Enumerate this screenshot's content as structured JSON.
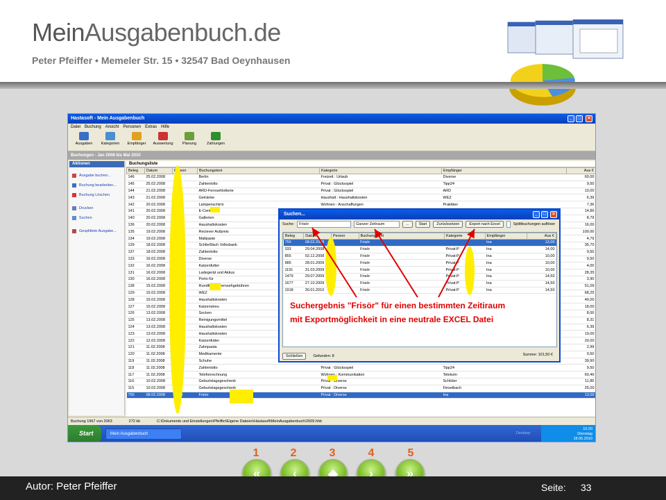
{
  "header": {
    "title_part1": "Mein",
    "title_part2": "Ausgabenbuch.de",
    "subtitle": "Peter Pfeiffer  •  Memeler Str. 15  •  32547 Bad Oeynhausen"
  },
  "app": {
    "window_title": "Hastasoft - Mein Ausgabenbuch",
    "menu": [
      "Datei",
      "Buchung",
      "Ansicht",
      "Personen",
      "Extras",
      "Hilfe"
    ],
    "toolbar": [
      {
        "label": "Ausgaben",
        "icon": "book-icon",
        "color": "#3a6fc4"
      },
      {
        "label": "Kategorien",
        "icon": "category-icon",
        "color": "#4a8fd4"
      },
      {
        "label": "Empfänger",
        "icon": "person-icon",
        "color": "#e0a020"
      },
      {
        "label": "Auswertung",
        "icon": "chart-icon",
        "color": "#c33"
      },
      {
        "label": "Planung",
        "icon": "planning-icon",
        "color": "#6a9f3a"
      },
      {
        "label": "Zahlungen",
        "icon": "money-icon",
        "color": "#2d8f2d"
      }
    ],
    "section_bar": "Buchungen - Jan 2008 bis Mai 2010",
    "actions": {
      "heading": "Aktionen",
      "items": [
        "Ausgabe buchen...",
        "Buchung bearbeiten...",
        "Buchung Löschen",
        "Drucken",
        "Suchen",
        "Gesplittete Ausgabe..."
      ]
    },
    "list_title": "Buchungsliste",
    "columns": [
      "Beleg",
      "Datum",
      "Person",
      "Buchungstext",
      "Kategorie",
      "Empfänger",
      "Aus €"
    ],
    "rows": [
      [
        "146",
        "25.02.2008",
        "",
        "Berlin",
        "Freizeit : Urlaub",
        "Diverse",
        "60,00"
      ],
      [
        "145",
        "25.02.2008",
        "P",
        "Zahlenlotto",
        "Privat : Glücksspiel",
        "Tipp24",
        "9,50"
      ],
      [
        "144",
        "21.02.2008",
        "",
        "ARD-Fernsehlotterie",
        "Privat : Glücksspiel",
        "ARD",
        "10,00"
      ],
      [
        "143",
        "21.02.2008",
        "",
        "Getränke",
        "Haushalt : Haushaltskosten",
        "WEZ",
        "6,39"
      ],
      [
        "142",
        "20.02.2008",
        "",
        "Lampenschirm",
        "Wohnen : Anschaffungen",
        "Praktiker",
        "7,36"
      ],
      [
        "141",
        "20.02.2008",
        "",
        "E-Center",
        "",
        "",
        "14,86"
      ],
      [
        "140",
        "20.02.2008",
        "",
        "Gallerien",
        "",
        "",
        "8,79"
      ],
      [
        "136",
        "20.02.2008",
        "",
        "Haushaltskosten",
        "",
        "",
        "16,00"
      ],
      [
        "135",
        "19.02.2008",
        "",
        "Reciever Aufpreis",
        "",
        "",
        "100,00"
      ],
      [
        "134",
        "19.02.2008",
        "",
        "Maltpaste",
        "",
        "",
        "4,79"
      ],
      [
        "139",
        "18.02.2008",
        "",
        "Schließfach Volksbank",
        "",
        "",
        "35,70"
      ],
      [
        "137",
        "18.02.2008",
        "",
        "Zahlenlotto",
        "",
        "",
        "9,50"
      ],
      [
        "133",
        "16.02.2008",
        "",
        "Diverse",
        "",
        "",
        "9,50"
      ],
      [
        "132",
        "16.02.2008",
        "",
        "Katzenfutter",
        "",
        "",
        "4,00"
      ],
      [
        "131",
        "16.02.2008",
        "",
        "Ladegerät und Akkus",
        "",
        "",
        "28,35"
      ],
      [
        "130",
        "16.02.2008",
        "",
        "Porto für",
        "",
        "",
        "3,90"
      ],
      [
        "138",
        "15.02.2008",
        "",
        "Rundfunk-&Fernsehgebühren",
        "",
        "",
        "51,09"
      ],
      [
        "129",
        "15.02.2008",
        "",
        "WEZ",
        "",
        "",
        "68,25"
      ],
      [
        "128",
        "15.02.2008",
        "",
        "Haushaltskosten",
        "",
        "",
        "40,00"
      ],
      [
        "127",
        "15.02.2008",
        "",
        "Katzenstreu",
        "",
        "",
        "18,00"
      ],
      [
        "126",
        "13.02.2008",
        "",
        "Socken",
        "",
        "",
        "8,00"
      ],
      [
        "125",
        "13.02.2008",
        "",
        "Reinigungsmittel",
        "",
        "",
        "8,31"
      ],
      [
        "124",
        "13.02.2008",
        "",
        "Haushaltskosten",
        "",
        "",
        "6,39"
      ],
      [
        "123",
        "13.02.2008",
        "",
        "Haushaltskosten",
        "",
        "",
        "19,00"
      ],
      [
        "122",
        "12.02.2008",
        "",
        "Katzenfutter",
        "",
        "",
        "20,00"
      ],
      [
        "121",
        "11.02.2008",
        "",
        "Zahnpasta",
        "",
        "",
        "2,99"
      ],
      [
        "120",
        "11.02.2008",
        "",
        "Medikamente",
        "",
        "",
        "9,50"
      ],
      [
        "119",
        "11.02.2008",
        "",
        "Schuhe",
        "Privat : ",
        "Vorhölter",
        "39,90"
      ],
      [
        "118",
        "11.02.2008",
        "",
        "Zahlenlotto",
        "Privat : Glücksspiel",
        "Tipp24",
        "9,50"
      ],
      [
        "117",
        "11.02.2008",
        "",
        "Telefonrechnung",
        "Wohnen : Kommunikation",
        "Telekom",
        "60,46"
      ],
      [
        "116",
        "10.02.2008",
        "",
        "Geburtstagsgeschenk",
        "Privat : Diverse",
        "Schlüter",
        "11,85"
      ],
      [
        "115",
        "10.02.2008",
        "",
        "Geburtstagsgeschenk",
        "Privat : Diverse",
        "Finselbach",
        "25,00"
      ],
      [
        "755",
        "08.02.2008",
        "Peter",
        "Frisör",
        "Privat : Diverse",
        "Ina",
        "13,00"
      ]
    ],
    "status": {
      "count": "Buchung 1967 von 2063",
      "size": "272 kb",
      "path": "C:\\Dokumente und Einstellungen\\Pfeiffer\\Eigene Dateien\\Hastasoft\\MeinAusgabenbuch\\2009.hhb"
    },
    "taskbar": {
      "start": "Start",
      "task": "Mein Ausgabenbuch",
      "desktop": "Desktop",
      "time": "10:20",
      "day": "Dienstag",
      "date": "18.05.2010"
    }
  },
  "dialog": {
    "title": "Suchen...",
    "search_label": "Suche:",
    "search_value": "Frisör",
    "range_value": "Ganzer Zeitraum",
    "start_btn": "Start",
    "reset_btn": "Zurücksetzen",
    "export_btn": "Export nach Excel",
    "split_label": "Splittbuchungen auflöser",
    "columns": [
      "Beleg",
      "Datum",
      "Person",
      "Buchungstext",
      "Kategorie",
      "Empfänger",
      "Aus €"
    ],
    "rows": [
      [
        "755",
        "08.02.2008",
        "",
        "Frisör",
        "",
        "Ina",
        "13,00"
      ],
      [
        "333",
        "29.04.2008",
        "",
        "Frisör",
        "Privat:P",
        "Ina",
        "14,00"
      ],
      [
        "855",
        "02.12.2008",
        "",
        "Frisör",
        "Privat:P",
        "Ina",
        "10,00"
      ],
      [
        "985",
        "28.01.2009",
        "",
        "Frisör",
        "Privat:P",
        "Ina",
        "10,00"
      ],
      [
        "1191",
        "31.03.2009",
        "",
        "Frisör",
        "Privat:P",
        "Ina",
        "10,00"
      ],
      [
        "1479",
        "29.07.2009",
        "",
        "Frisör",
        "Privat:P",
        "Ina",
        "14,50"
      ],
      [
        "1677",
        "27.10.2009",
        "",
        "Frisör",
        "Privat:P",
        "Ina",
        "14,50"
      ],
      [
        "1918",
        "30.01.2010",
        "",
        "Frisör",
        "Privat:P",
        "Ina",
        "14,50"
      ]
    ],
    "close_btn": "Schließen",
    "found": "Gefunden: 8",
    "sum": "Summe: 101,50 €"
  },
  "annotation": {
    "line1": "Suchergebnis \"Frisör\" für einen bestimmten Zeitiraum",
    "line2": "mit Exportmöglichkeit in eine neutrale EXCEL Datei"
  },
  "nav": {
    "numbers": [
      "1",
      "2",
      "3",
      "4",
      "5"
    ],
    "buttons": [
      {
        "name": "first-page-button",
        "glyph": "«"
      },
      {
        "name": "previous-page-button",
        "glyph": "‹"
      },
      {
        "name": "home-button",
        "glyph": "◆"
      },
      {
        "name": "next-page-button",
        "glyph": "›"
      },
      {
        "name": "last-page-button",
        "glyph": "»"
      }
    ]
  },
  "footer": {
    "author": "Autor: Peter Pfeiffer",
    "page_label": "Seite:",
    "page_number": "33"
  },
  "colors": {
    "highlight": "#ffee00",
    "annotation": "#e00000",
    "nav_number": "#e0601a",
    "nav_button": "#7fbf2a"
  }
}
